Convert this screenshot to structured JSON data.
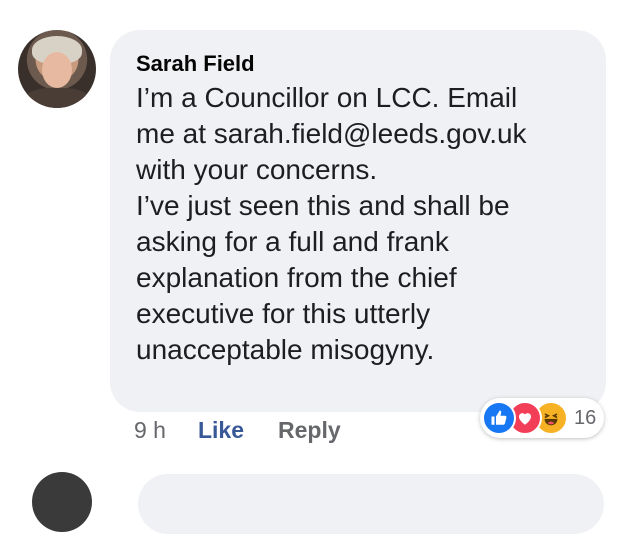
{
  "comment": {
    "author": "Sarah Field",
    "text": "I’m a Councillor on LCC. Email\nme at sarah.field@leeds.gov.uk\nwith your concerns.\nI’ve just seen this and shall be\nasking for a full and frank\nexplanation from the chief\nexecutive for this utterly\nunacceptable misogyny.",
    "time": "9 h",
    "like_label": "Like",
    "reply_label": "Reply",
    "reactions": {
      "icons": [
        "like-icon",
        "love-icon",
        "haha-icon"
      ],
      "count": "16"
    }
  },
  "colors": {
    "bubble": "#f0f1f4",
    "like_link": "#385898",
    "muted": "#65676b",
    "like_reaction": "#1877f2",
    "love_reaction": "#f33e58",
    "haha_reaction": "#f7b125"
  }
}
